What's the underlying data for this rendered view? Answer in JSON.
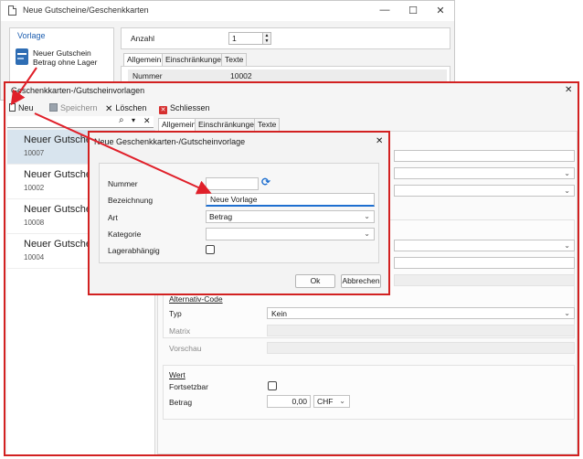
{
  "back_window": {
    "title": "Neue Gutscheine/Geschenkkarten",
    "controls": {
      "minimize": "—",
      "maximize": "☐",
      "close": "✕"
    },
    "vorlage_label": "Vorlage",
    "template_item": {
      "line1": "Neuer Gutschein",
      "line2": "Betrag ohne Lager"
    },
    "anzahl_label": "Anzahl",
    "anzahl_value": "1",
    "tabs": [
      "Allgemein",
      "Einschränkungen",
      "Texte"
    ],
    "nummer_label": "Nummer",
    "nummer_value": "10002"
  },
  "main_window": {
    "title": "Geschenkkarten-/Gutscheinvorlagen",
    "close": "✕",
    "toolbar": {
      "new": "Neu",
      "save": "Speichern",
      "delete": "Löschen",
      "close": "Schliessen"
    },
    "search_icon": "⌕",
    "search_dropdown": "▾",
    "search_clear": "✕",
    "tabs": [
      "Allgemein",
      "Einschränkungen",
      "Texte"
    ],
    "list": [
      {
        "name": "Neuer Gutschein",
        "code": "10007"
      },
      {
        "name": "Neuer Gutschein",
        "code": "10002"
      },
      {
        "name": "Neuer Gutschein",
        "code": "10008"
      },
      {
        "name": "Neuer Gutschein",
        "code": "10004"
      }
    ],
    "alternativ_code": {
      "title": "Alternativ-Code",
      "typ_label": "Typ",
      "typ_value": "Kein",
      "matrix_label": "Matrix",
      "vorschau_label": "Vorschau"
    },
    "wert": {
      "title": "Wert",
      "fortsetzbar_label": "Fortsetzbar",
      "betrag_label": "Betrag",
      "betrag_value": "0,00",
      "currency": "CHF"
    }
  },
  "dialog": {
    "title": "Neue Geschenkkarten-/Gutscheinvorlage",
    "close": "✕",
    "nummer_label": "Nummer",
    "nummer_refresh": "⟳",
    "bezeichnung_label": "Bezeichnung",
    "bezeichnung_value": "Neue Vorlage",
    "art_label": "Art",
    "art_value": "Betrag",
    "kategorie_label": "Kategorie",
    "lagerabhaengig_label": "Lagerabhängig",
    "ok": "Ok",
    "cancel": "Abbrechen"
  },
  "colors": {
    "highlight": "#d22121",
    "selection": "#d8e4ee",
    "arrow": "#e0202a",
    "accent": "#1e6fd0"
  }
}
